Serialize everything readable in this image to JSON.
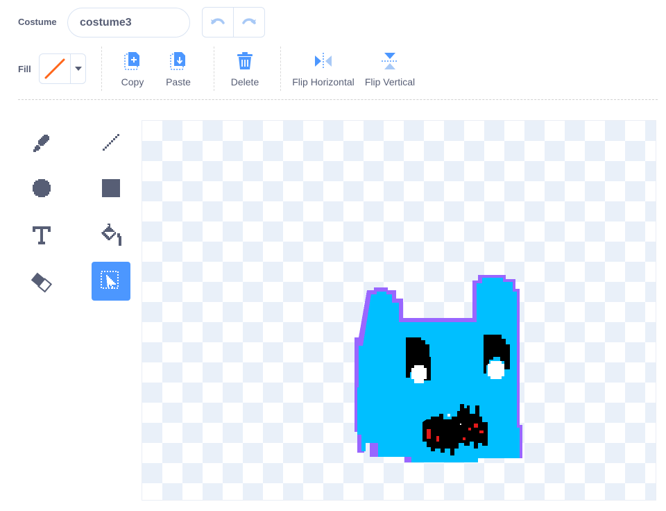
{
  "costume": {
    "label": "Costume",
    "name": "costume3"
  },
  "fill": {
    "label": "Fill",
    "swatch_color": "#ff661a"
  },
  "actions": {
    "copy": "Copy",
    "paste": "Paste",
    "delete": "Delete",
    "flip_horizontal": "Flip Horizontal",
    "flip_vertical": "Flip Vertical"
  },
  "tools": [
    "brush",
    "line",
    "circle",
    "rectangle",
    "text",
    "fill",
    "eraser",
    "select"
  ],
  "active_tool": "select",
  "colors": {
    "accent": "#4c97ff",
    "text": "#575e75",
    "sprite_fill": "#00bfff",
    "sprite_outline": "#9966ff"
  }
}
